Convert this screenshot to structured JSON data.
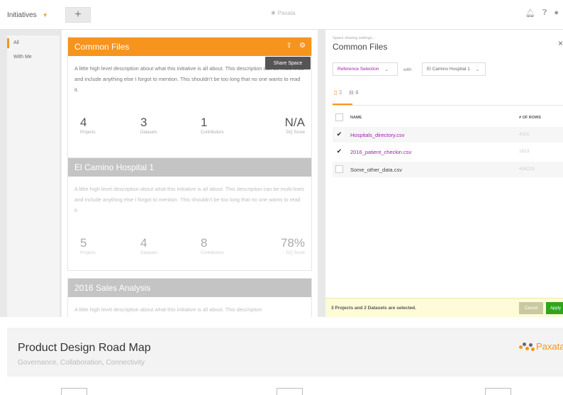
{
  "topbar": {
    "initiatives_label": "Initiatives",
    "search_text": "Paxata"
  },
  "leftnav": {
    "items": [
      {
        "label": "All",
        "active": true
      },
      {
        "label": "With Me",
        "active": false
      }
    ]
  },
  "cards": [
    {
      "title": "Common Files",
      "description": "A little high level description about what this initiative is all about. This description can be multi-lines and include anything else I forgot to mention.  This shouldn't be too long that no one wants to read it.",
      "stats": [
        {
          "value": "4",
          "label": "Projects"
        },
        {
          "value": "3",
          "label": "Datasets"
        },
        {
          "value": "1",
          "label": "Contributors"
        },
        {
          "value": "N/A",
          "label": "DQ Score"
        }
      ]
    },
    {
      "title": "El Camino Hospital 1",
      "description": "A little high level description about what this initiative is all about. This description can be multi-lines and include anything else I forgot to mention.  This shouldn't be too long that no one wants to read it.",
      "stats": [
        {
          "value": "5",
          "label": "Projects"
        },
        {
          "value": "4",
          "label": "Datasets"
        },
        {
          "value": "8",
          "label": "Contributors"
        },
        {
          "value": "78%",
          "label": "DQ Score"
        }
      ]
    },
    {
      "title": "2016 Sales Analysis",
      "description": "A little high level description about what this initiative is all about. This description"
    }
  ],
  "tooltip": "Share Space",
  "panel": {
    "subtitle": "Space sharing settings...",
    "title": "Common Files",
    "dropdown_reference": "Reference Selection",
    "with_label": "with",
    "dropdown_target": "El Camino Hospital 1",
    "tab_projects_count": "3",
    "tab_datasets_count": "4",
    "col_name": "NAME",
    "col_rows": "# OF ROWS",
    "rows": [
      {
        "name": "Hospitals_directory.csv",
        "rows": "4321",
        "checked": true
      },
      {
        "name": "2016_patient_checkin.csv",
        "rows": "1623",
        "checked": true
      },
      {
        "name": "Some_other_data.csv",
        "rows": "434213",
        "checked": false
      }
    ],
    "footer_message": "3 Projects and 2 Datasets are selected.",
    "cancel_label": "Cancel",
    "apply_label": "Apply"
  },
  "banner": {
    "title": "Product Design Road Map",
    "subtitle": "Governance, Collaboration, Connectivity",
    "brand": "Paxata"
  },
  "colors": {
    "accent": "#f7941d",
    "selected_text": "#a21caf",
    "apply": "#2ea51a"
  }
}
